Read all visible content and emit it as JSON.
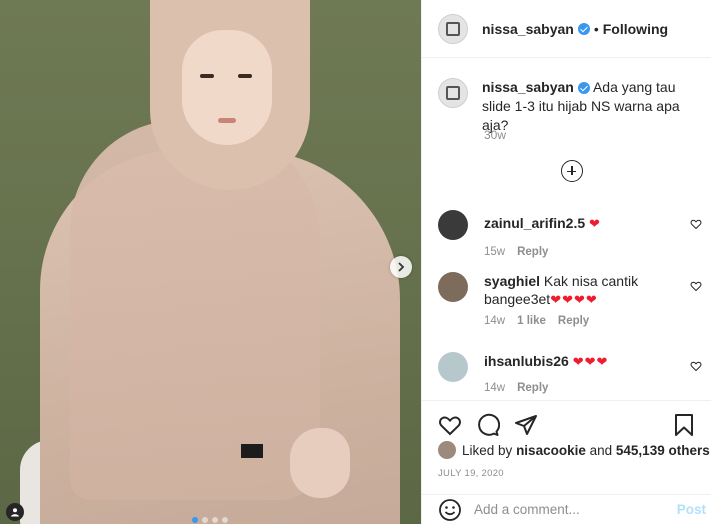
{
  "post": {
    "username": "nissa_sabyan",
    "follow_state": "Following",
    "separator": "•"
  },
  "caption": {
    "username": "nissa_sabyan",
    "text": "Ada yang tau slide 1-3 itu hijab NS warna apa aja?",
    "time": "30w"
  },
  "comments": [
    {
      "username": "zainul_arifin2.5",
      "text": "",
      "hearts": "❤",
      "time": "15w",
      "likes": "",
      "reply": "Reply",
      "avatar_color": "#3a3a3a"
    },
    {
      "username": "syaghiel",
      "text": "Kak nisa cantik bangee3et",
      "hearts": "❤❤❤❤",
      "time": "14w",
      "likes": "1 like",
      "reply": "Reply",
      "avatar_color": "#7d6b5c"
    },
    {
      "username": "ihsanlubis26",
      "text": "",
      "hearts": "❤❤❤",
      "time": "14w",
      "likes": "",
      "reply": "Reply",
      "avatar_color": "#b7c8cc"
    }
  ],
  "likes": {
    "prefix": "Liked by",
    "user": "nisacookie",
    "connector": "and",
    "others": "545,139 others"
  },
  "date": "JULY 19, 2020",
  "comment_box": {
    "placeholder": "Add a comment...",
    "post_label": "Post"
  },
  "icons": {
    "like": "heart-icon",
    "comment": "comment-icon",
    "share": "share-icon",
    "save": "bookmark-icon",
    "emoji": "emoji-icon",
    "next": "chevron-right-icon",
    "tag": "user-tag-icon"
  },
  "colors": {
    "verified": "#3897f0",
    "heart": "#ed1c2e",
    "post_disabled": "#b2dffc"
  },
  "carousel": {
    "slides": 4,
    "active_index": 0
  }
}
